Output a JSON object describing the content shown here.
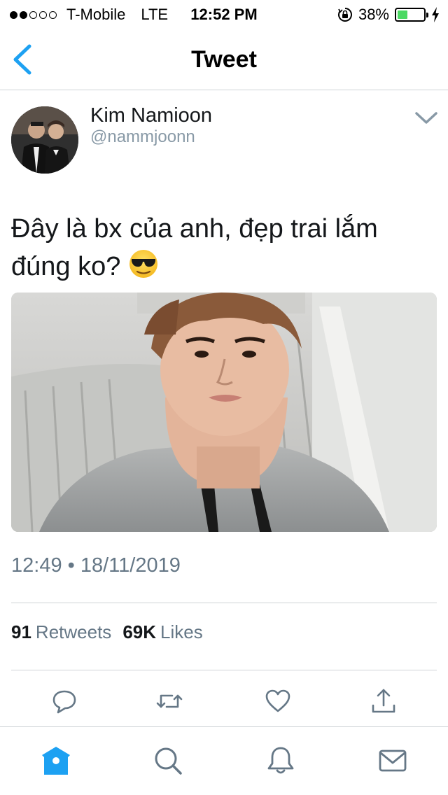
{
  "status_bar": {
    "signal_dots_filled": 2,
    "signal_dots_total": 5,
    "carrier": "T-Mobile",
    "network": "LTE",
    "time": "12:52 PM",
    "battery_percent_label": "38%",
    "battery_level": 0.38
  },
  "nav": {
    "title": "Tweet",
    "back_icon": "chevron-left-icon"
  },
  "tweet": {
    "display_name": "Kim Namioon",
    "handle": "@nammjoonn",
    "text": "Đây là bx của anh, đẹp trai lắm đúng ko?",
    "emoji": "smiling-face-with-sunglasses",
    "timestamp": "12:49 • 18/11/2019",
    "retweets_count": "91",
    "retweets_label": "Retweets",
    "likes_count": "69K",
    "likes_label": "Likes"
  },
  "actions": [
    "reply-icon",
    "retweet-icon",
    "like-icon",
    "share-icon"
  ],
  "tabbar": [
    "home-icon",
    "search-icon",
    "notifications-icon",
    "messages-icon"
  ],
  "colors": {
    "accent": "#1da1f2",
    "secondary_text": "#657786",
    "divider": "#cfd3d6",
    "battery": "#4cd964"
  }
}
